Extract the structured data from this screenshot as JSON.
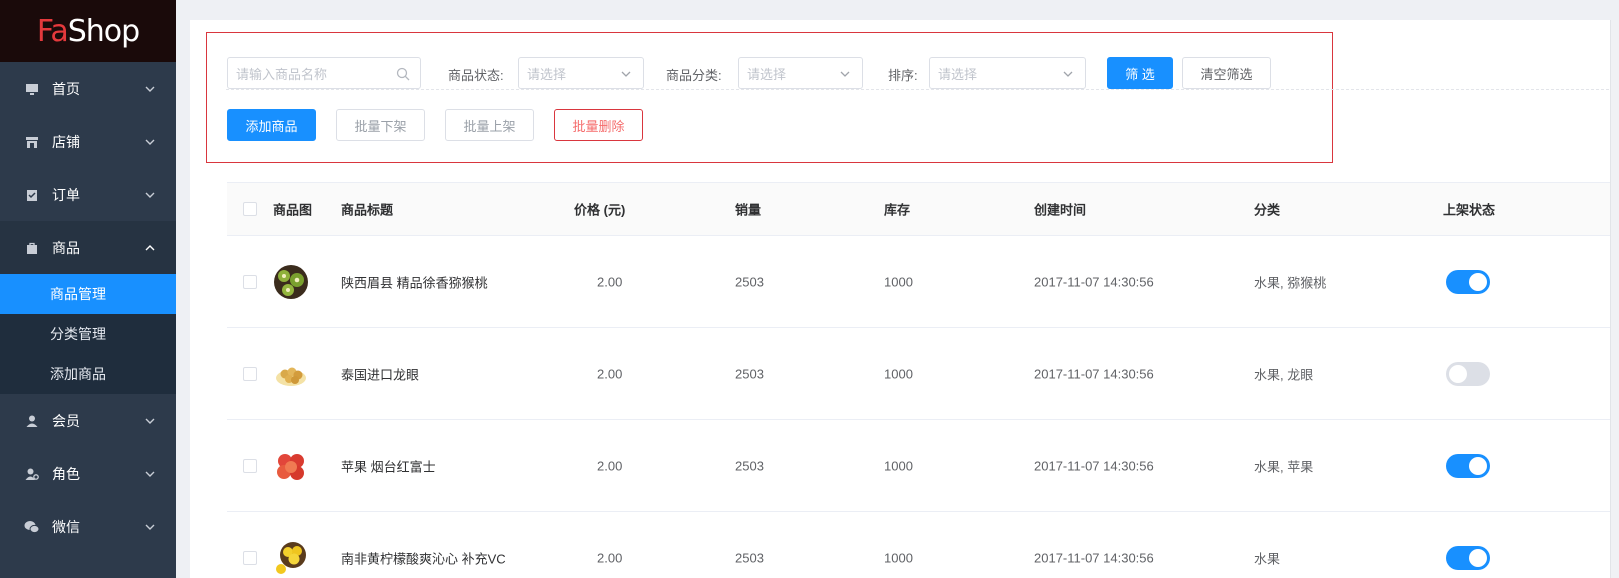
{
  "brand": {
    "logo_prefix": "Fa",
    "logo_suffix": "Shop"
  },
  "sidebar": {
    "items": [
      {
        "label": "首页",
        "icon": "monitor-icon"
      },
      {
        "label": "店铺",
        "icon": "store-icon"
      },
      {
        "label": "订单",
        "icon": "clipboard-icon"
      },
      {
        "label": "商品",
        "icon": "bag-icon",
        "expanded": true
      },
      {
        "label": "会员",
        "icon": "user-icon"
      },
      {
        "label": "角色",
        "icon": "user-settings-icon"
      },
      {
        "label": "微信",
        "icon": "wechat-icon"
      }
    ],
    "submenu": [
      {
        "label": "商品管理",
        "active": true
      },
      {
        "label": "分类管理"
      },
      {
        "label": "添加商品"
      }
    ]
  },
  "filters": {
    "search_placeholder": "请输入商品名称",
    "status_label": "商品状态:",
    "status_placeholder": "请选择",
    "category_label": "商品分类:",
    "category_placeholder": "请选择",
    "sort_label": "排序:",
    "sort_placeholder": "请选择",
    "filter_button": "筛 选",
    "clear_button": "清空筛选"
  },
  "actions": {
    "add": "添加商品",
    "batch_off": "批量下架",
    "batch_on": "批量上架",
    "batch_delete": "批量删除"
  },
  "table": {
    "columns": [
      "商品图",
      "商品标题",
      "价格 (元)",
      "销量",
      "库存",
      "创建时间",
      "分类",
      "上架状态"
    ],
    "rows": [
      {
        "title": "陕西眉县 精品徐香猕猴桃",
        "price": "2.00",
        "sales": "2503",
        "stock": "1000",
        "created": "2017-11-07 14:30:56",
        "category": "水果, 猕猴桃",
        "on_sale": true,
        "thumb": "kiwi-image"
      },
      {
        "title": "泰国进口龙眼",
        "price": "2.00",
        "sales": "2503",
        "stock": "1000",
        "created": "2017-11-07 14:30:56",
        "category": "水果, 龙眼",
        "on_sale": false,
        "thumb": "longan-image"
      },
      {
        "title": "苹果 烟台红富士",
        "price": "2.00",
        "sales": "2503",
        "stock": "1000",
        "created": "2017-11-07 14:30:56",
        "category": "水果, 苹果",
        "on_sale": true,
        "thumb": "apple-image"
      },
      {
        "title": "南非黄柠檬酸爽沁心 补充VC",
        "price": "2.00",
        "sales": "2503",
        "stock": "1000",
        "created": "2017-11-07 14:30:56",
        "category": "水果",
        "on_sale": true,
        "thumb": "lemon-image"
      }
    ]
  },
  "colors": {
    "primary": "#1890ff",
    "danger": "#d9363e",
    "sidebar_bg": "#2d3a4b",
    "logo_red": "#e4393c"
  }
}
